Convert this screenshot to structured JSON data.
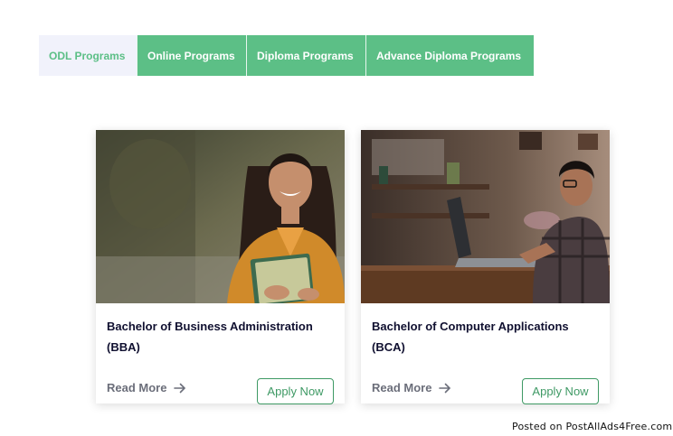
{
  "tabs": [
    {
      "label": "ODL Programs",
      "active": true
    },
    {
      "label": "Online Programs",
      "active": false
    },
    {
      "label": "Diploma Programs",
      "active": false
    },
    {
      "label": "Advance Diploma Programs",
      "active": false
    }
  ],
  "cards": [
    {
      "image": "student-holding-books-photo",
      "title": "Bachelor of Business Administration (BBA)",
      "read_more": "Read More",
      "apply": "Apply Now"
    },
    {
      "image": "student-using-laptop-photo",
      "title": "Bachelor of Computer Applications (BCA)",
      "read_more": "Read More",
      "apply": "Apply Now"
    }
  ],
  "watermark": "Posted on PostAllAds4Free.com",
  "colors": {
    "accent": "#5cbf86",
    "button_border": "#3e9964",
    "active_tab_bg": "#f1f2fb"
  }
}
